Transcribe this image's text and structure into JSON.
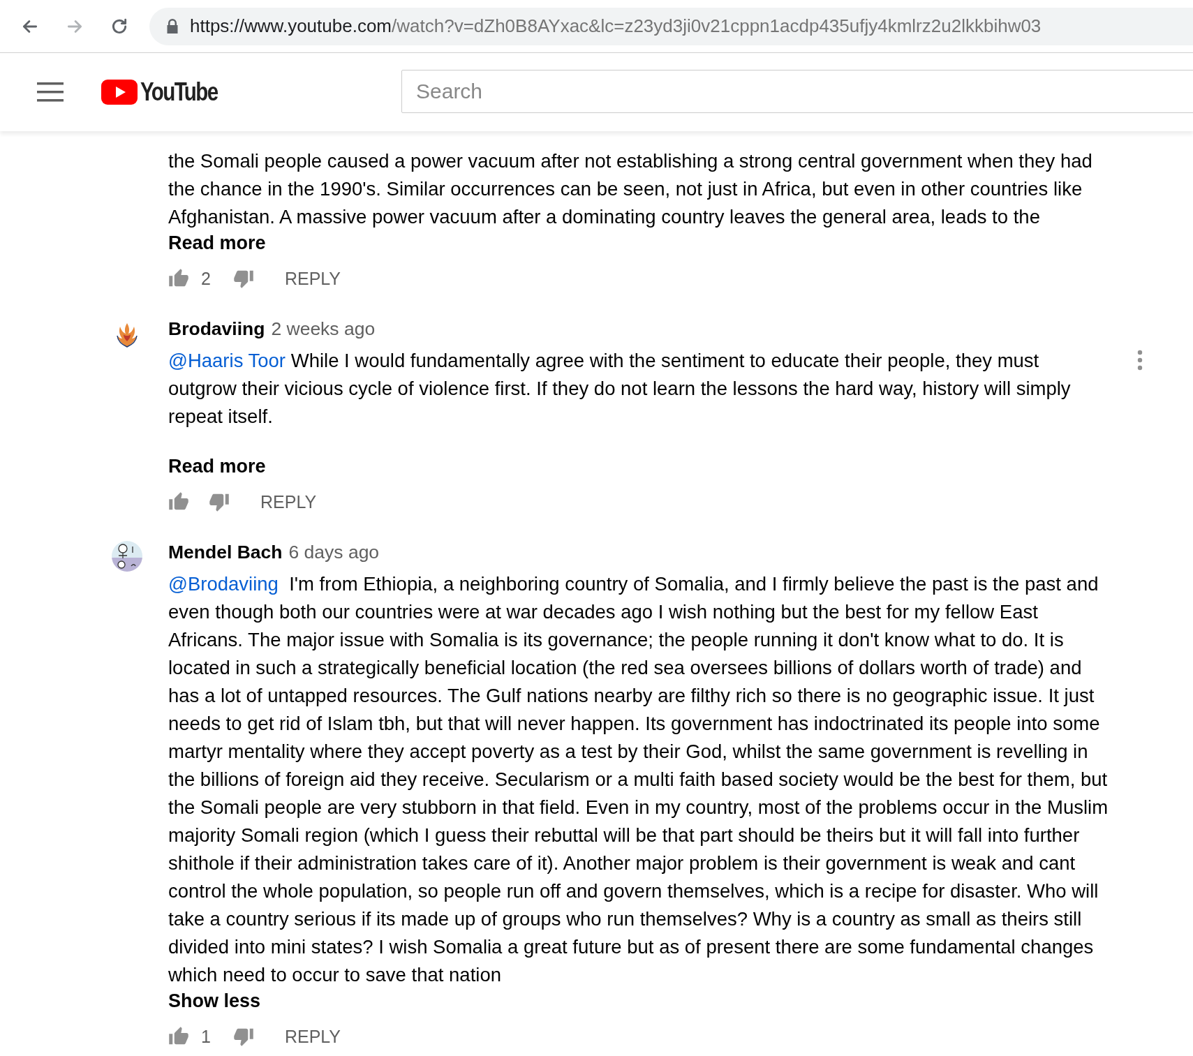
{
  "browser": {
    "url_host": "https://www.youtube.com",
    "url_rest": "/watch?v=dZh0B8AYxac&lc=z23yd3ji0v21cppn1acdp435ufjy4kmlrz2u2lkkbihw03"
  },
  "header": {
    "logo": "YouTube",
    "search": {
      "placeholder": "Search"
    }
  },
  "comments": [
    {
      "text": "the Somali people caused a power vacuum after not establishing a strong central government when they had the chance in the 1990's. Similar occurrences can be seen, not just in Africa, but even in other countries like Afghanistan. A massive power vacuum after a dominating country leaves the general area, leads to the",
      "spacer": false,
      "toggle": "Read more",
      "likes": "2",
      "reply": "REPLY",
      "menu": false
    },
    {
      "avatar": {
        "kind": "phoenix"
      },
      "author": "Brodaviing",
      "time": "2 weeks ago",
      "mention": "@Haaris Toor",
      "text": "While I would fundamentally agree with the sentiment to educate their people, they must outgrow their vicious cycle of violence first. If they do not learn the lessons the hard way, history will simply repeat itself.",
      "spacer": true,
      "toggle": "Read more",
      "reply": "REPLY",
      "menu": true
    },
    {
      "avatar": {
        "kind": "doodle"
      },
      "author": "Mendel Bach",
      "time": "6 days ago",
      "mention": "@Brodaviing",
      "text": " I'm from Ethiopia, a neighboring country of Somalia, and I firmly believe the past is the past and even though both our countries were at war decades ago I wish nothing but the best for my fellow East Africans. The major issue with Somalia is its governance; the people running it don't know what to do. It is located in such a strategically beneficial location (the red sea oversees billions of dollars worth of trade) and has a lot of untapped resources. The Gulf nations nearby are filthy rich so there is no geographic issue. It just needs to get rid of Islam tbh, but that will never happen. Its government has indoctrinated its people into some martyr mentality where they accept poverty as a test by their God, whilst the same government is revelling in the billions of foreign aid they receive. Secularism or a multi faith based society would be the best for them, but the Somali people are very stubborn in that field. Even in my country, most of the problems occur in the Muslim majority Somali region (which I guess their rebuttal will be that part should be theirs but it will fall into further shithole if their administration takes care of it). Another major problem is their government is weak and cant control the whole population, so people run off and govern themselves, which is a recipe for disaster. Who will take a country serious if its made up of groups who run themselves? Why is a country as small as theirs still divided into mini states? I wish Somalia a great future but as of present there are some fundamental changes which need to occur to save that nation",
      "spacer": false,
      "toggle": "Show less",
      "likes": "1",
      "reply": "REPLY",
      "menu": false
    }
  ]
}
